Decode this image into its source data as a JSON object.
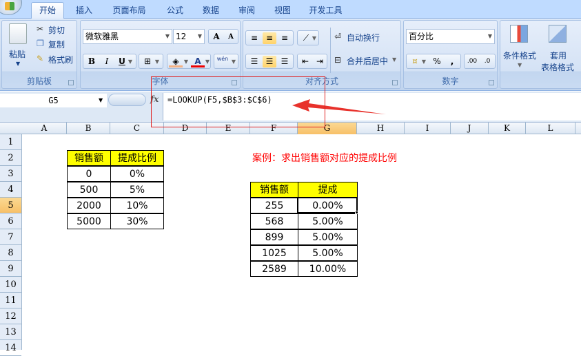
{
  "tabs": [
    {
      "label": "开始",
      "active": true
    },
    {
      "label": "插入"
    },
    {
      "label": "页面布局"
    },
    {
      "label": "公式"
    },
    {
      "label": "数据"
    },
    {
      "label": "审阅"
    },
    {
      "label": "视图"
    },
    {
      "label": "开发工具"
    }
  ],
  "ribbon": {
    "clipboard": {
      "paste": "粘贴",
      "cut": "剪切",
      "copy": "复制",
      "format_painter": "格式刷",
      "label": "剪贴板"
    },
    "font": {
      "name": "微软雅黑",
      "size": "12",
      "bold": "B",
      "italic": "I",
      "underline": "U",
      "grow": "A",
      "shrink": "A",
      "font_color": "A",
      "phonetic": "wén",
      "label": "字体"
    },
    "alignment": {
      "wrap": "自动换行",
      "merge": "合并后居中",
      "label": "对齐方式"
    },
    "number": {
      "format": "百分比",
      "percent": "%",
      "comma": ",",
      "inc_decimal": ".00",
      "dec_decimal": ".0",
      "label": "数字"
    },
    "styles": {
      "conditional": "条件格式",
      "table_format_1": "套用",
      "table_format_2": "表格格式"
    }
  },
  "formula_bar": {
    "name_box": "G5",
    "fx": "fx",
    "formula": "=LOOKUP(F5,$B$3:$C$6)"
  },
  "columns": [
    "A",
    "B",
    "C",
    "D",
    "E",
    "F",
    "G",
    "H",
    "I",
    "J",
    "K",
    "L"
  ],
  "selected_column": "G",
  "rows": [
    "1",
    "2",
    "3",
    "4",
    "5",
    "6",
    "7",
    "8",
    "9",
    "10",
    "11",
    "12",
    "13",
    "14"
  ],
  "selected_row": "5",
  "table1": {
    "headers": [
      "销售额",
      "提成比例"
    ],
    "rows": [
      [
        "0",
        "0%"
      ],
      [
        "500",
        "5%"
      ],
      [
        "2000",
        "10%"
      ],
      [
        "5000",
        "30%"
      ]
    ]
  },
  "caption": "案例：求出销售额对应的提成比例",
  "table2": {
    "headers": [
      "销售额",
      "提成"
    ],
    "rows": [
      [
        "255",
        "0.00%"
      ],
      [
        "568",
        "5.00%"
      ],
      [
        "899",
        "5.00%"
      ],
      [
        "1025",
        "5.00%"
      ],
      [
        "2589",
        "10.00%"
      ]
    ]
  },
  "colors": {
    "header_fill": "#ffff00",
    "annotation": "#e02020",
    "caption": "#ff0000",
    "selection": "#f7c068"
  }
}
